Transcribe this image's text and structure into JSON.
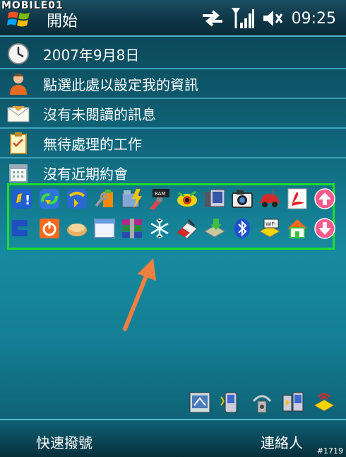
{
  "watermark": "MOBILE01",
  "title": "開始",
  "status": {
    "time": "09:25",
    "icons": [
      "sync-arrows-icon",
      "signal-icon",
      "volume-icon"
    ]
  },
  "today": [
    {
      "icon": "clock-icon",
      "label": "2007年9月8日"
    },
    {
      "icon": "owner-info-icon",
      "label": "點選此處以設定我的資訊"
    },
    {
      "icon": "message-icon",
      "label": "沒有未閱讀的訊息"
    },
    {
      "icon": "tasks-icon",
      "label": "無待處理的工作"
    },
    {
      "icon": "calendar-icon",
      "label": "沒有近期約會"
    }
  ],
  "launcher": {
    "row1": [
      "alert-icon",
      "phone-sync-icon",
      "phone-reply-icon",
      "tools-icon",
      "power-folder-icon",
      "ram-icon",
      "eye-icon",
      "display-icon",
      "camera-icon",
      "car-icon",
      "acrobat-icon",
      "scroll-up-icon"
    ],
    "row2": [
      "e-logo-icon",
      "power-button-icon",
      "bread-icon",
      "window-icon",
      "archive-icon",
      "snowflake-icon",
      "eraser-icon",
      "install-icon",
      "bluetooth-icon",
      "wifi-icon",
      "home-icon",
      "scroll-down-icon"
    ]
  },
  "tray": [
    "tray-app-1-icon",
    "tray-app-2-icon",
    "tray-app-3-icon",
    "tray-app-4-icon",
    "tray-app-5-icon"
  ],
  "softkeys": {
    "left": "快速撥號",
    "right": "連絡人"
  },
  "serial": "#1719",
  "colors": {
    "highlight": "#1fdd2a",
    "arrow": "#f08040",
    "divider": "#3fa1b6"
  }
}
